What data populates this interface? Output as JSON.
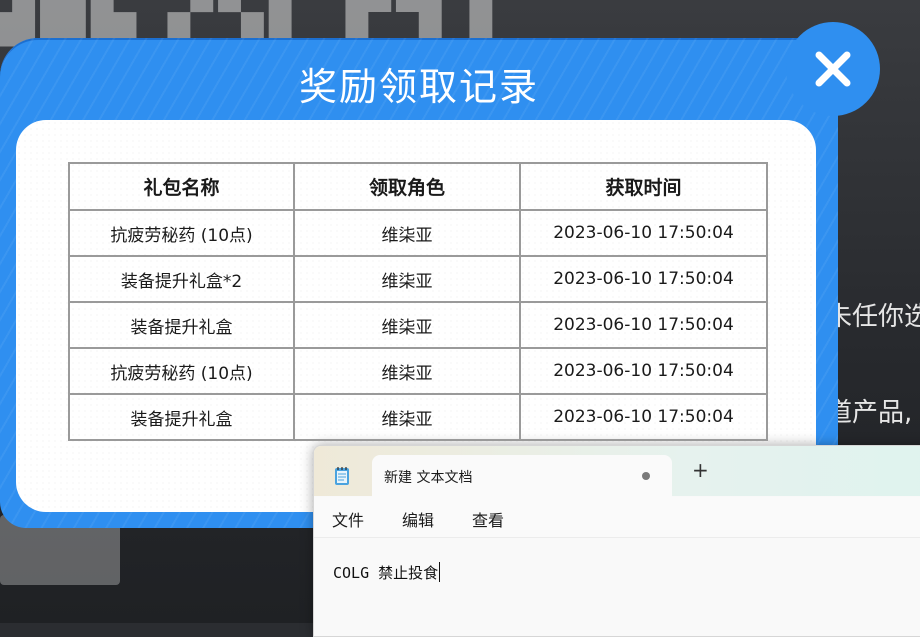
{
  "background": {
    "right_text_1": "未任你选",
    "right_text_2": "道产品,"
  },
  "modal": {
    "title": "奖励领取记录",
    "accent_color": "#2f8ff0",
    "columns": [
      "礼包名称",
      "领取角色",
      "获取时间"
    ],
    "rows": [
      {
        "name": "抗疲劳秘药 (10点)",
        "role": "维柒亚",
        "time": "2023-06-10 17:50:04"
      },
      {
        "name": "装备提升礼盒*2",
        "role": "维柒亚",
        "time": "2023-06-10 17:50:04"
      },
      {
        "name": "装备提升礼盒",
        "role": "维柒亚",
        "time": "2023-06-10 17:50:04"
      },
      {
        "name": "抗疲劳秘药 (10点)",
        "role": "维柒亚",
        "time": "2023-06-10 17:50:04"
      },
      {
        "name": "装备提升礼盒",
        "role": "维柒亚",
        "time": "2023-06-10 17:50:04"
      }
    ]
  },
  "notepad": {
    "tab_title": "新建 文本文档",
    "new_tab_label": "+",
    "menu": [
      "文件",
      "编辑",
      "查看"
    ],
    "content": "COLG 禁止投食"
  }
}
